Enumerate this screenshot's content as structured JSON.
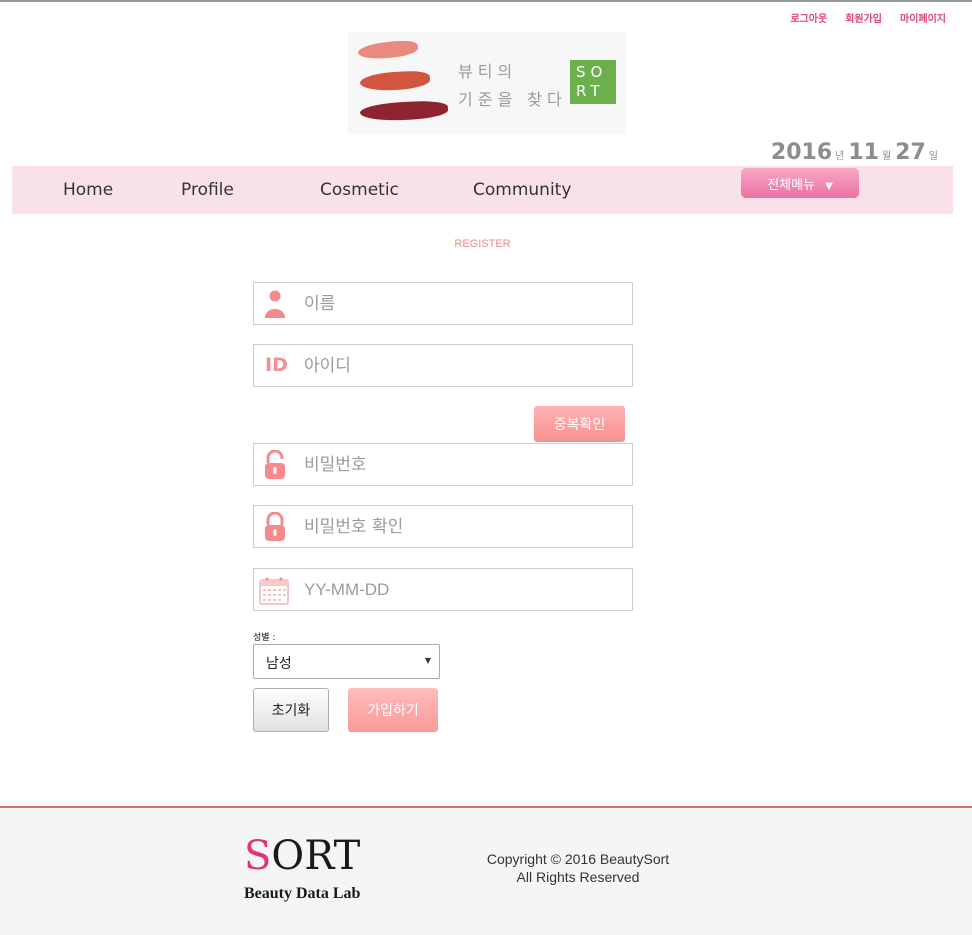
{
  "top_links": {
    "logout": "로그아웃",
    "signup": "회원가입",
    "mypage": "마이페이지"
  },
  "logo": {
    "line1": "뷰티의",
    "line2": "기준을 찾다",
    "badge_line1": "SO",
    "badge_line2": "RT"
  },
  "date": {
    "year": "2016",
    "year_unit": "년",
    "month": "11",
    "month_unit": "월",
    "day": "27",
    "day_unit": "일"
  },
  "nav": {
    "home": "Home",
    "profile": "Profile",
    "cosmetic": "Cosmetic",
    "community": "Community",
    "all_menu": "전체메뉴",
    "caret": "▼"
  },
  "register": {
    "title": "REGISTER",
    "name_placeholder": "이름",
    "id_badge": "ID",
    "id_placeholder": "아이디",
    "dup_check": "중복확인",
    "pw_placeholder": "비밀번호",
    "pw_confirm_placeholder": "비밀번호 확인",
    "birth_placeholder": "YY-MM-DD",
    "gender_label": "성별 :",
    "gender_value": "남성",
    "reset": "초기화",
    "join": "가입하기"
  },
  "footer": {
    "logo_s": "S",
    "logo_rest": "ORT",
    "tagline": "Beauty Data Lab",
    "copyright_line1": "Copyright © 2016 BeautySort",
    "copyright_line2": "All Rights Reserved"
  },
  "colors": {
    "accent_pink": "#e0457b",
    "nav_bg": "#f9e1ea",
    "salmon": "#f08a86",
    "green_badge": "#6cb04e"
  },
  "icons": [
    "person-icon",
    "id-icon",
    "unlock-icon",
    "lock-icon",
    "calendar-icon",
    "dropdown-arrow-icon"
  ]
}
